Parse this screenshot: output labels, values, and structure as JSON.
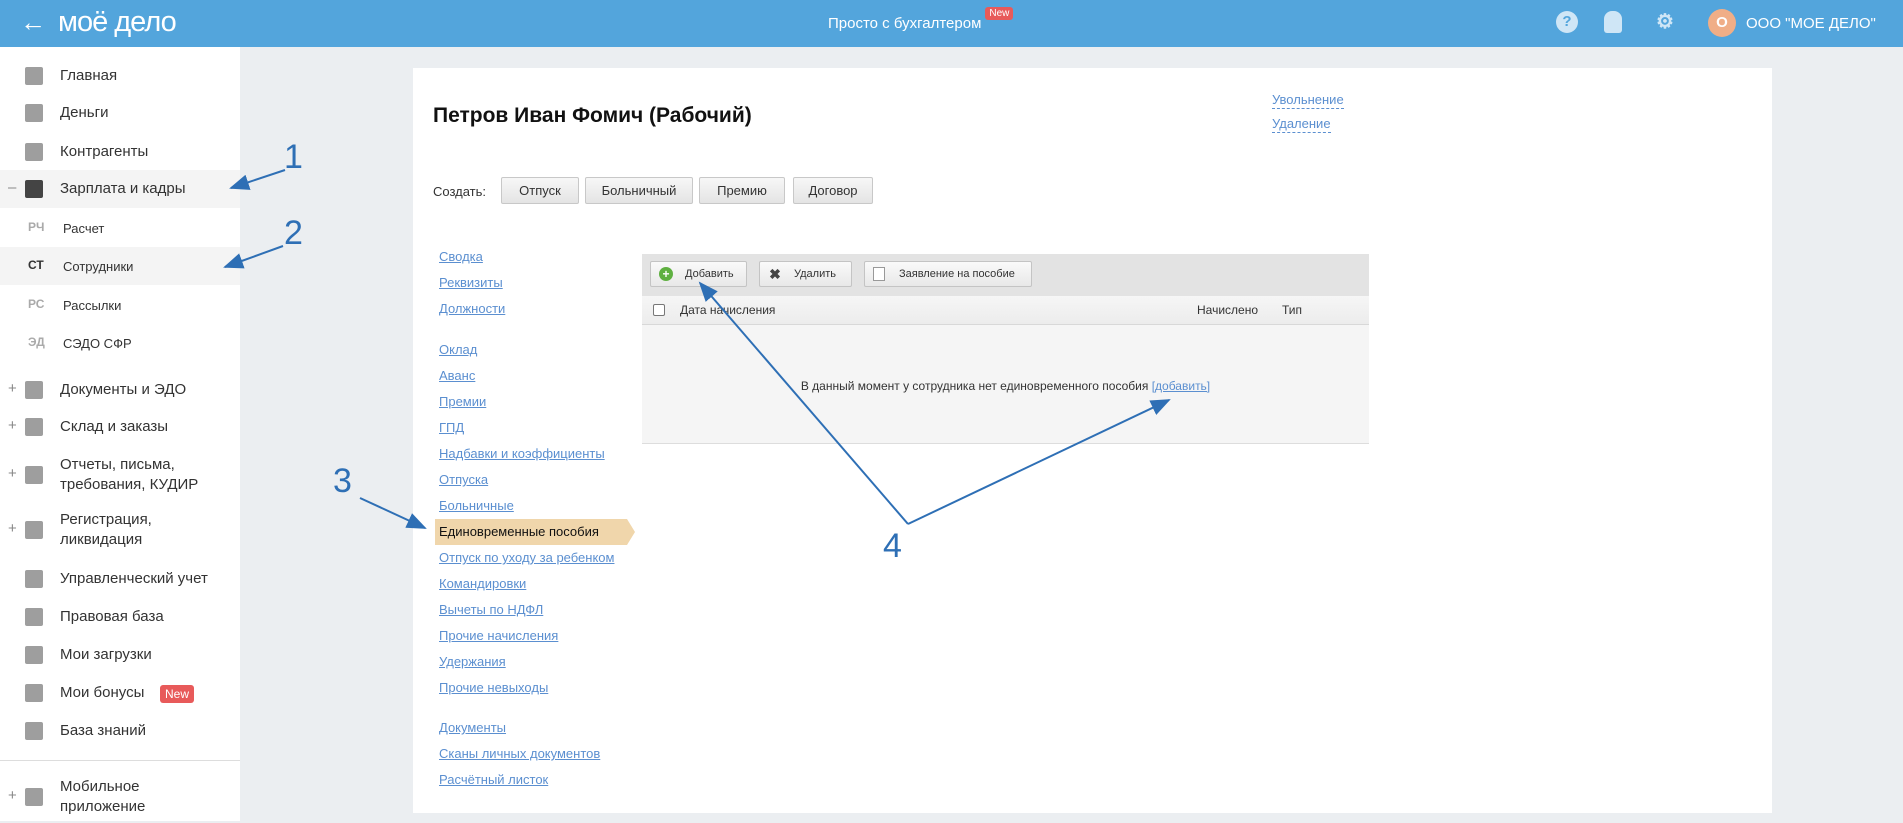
{
  "header": {
    "logo": "моё дело",
    "center_text": "Просто с бухгалтером",
    "center_badge": "New",
    "help_icon": "question-circle-icon",
    "bell_icon": "bell-icon",
    "settings_icon": "gear-icon",
    "avatar_letter": "О",
    "org_name": "ООО \"МОЕ ДЕЛО\"",
    "brand_color": "#53a5dc"
  },
  "sidebar": {
    "items": [
      {
        "label": "Главная",
        "icon": "home-icon"
      },
      {
        "label": "Деньги",
        "icon": "money-icon"
      },
      {
        "label": "Контрагенты",
        "icon": "person-icon"
      },
      {
        "label": "Зарплата и кадры",
        "icon": "wallet-icon",
        "toggle": "–"
      },
      {
        "label": "Документы и ЭДО",
        "icon": "folder-icon",
        "toggle": "+"
      },
      {
        "label": "Склад и заказы",
        "icon": "warehouse-icon",
        "toggle": "+"
      },
      {
        "label": "Отчеты, письма, требования, КУДИР",
        "icon": "report-icon",
        "toggle": "+"
      },
      {
        "label": "Регистрация, ликвидация",
        "icon": "registration-icon",
        "toggle": "+"
      },
      {
        "label": "Управленческий учет",
        "icon": "ruble-icon"
      },
      {
        "label": "Правовая база",
        "icon": "briefcase-icon"
      },
      {
        "label": "Мои загрузки",
        "icon": "folder-icon"
      },
      {
        "label": "Мои бонусы",
        "icon": "gift-icon",
        "badge": "New"
      },
      {
        "label": "База знаний",
        "icon": "graduation-cap-icon"
      },
      {
        "label": "Мобильное приложение",
        "icon": "mobile-icon",
        "toggle": "+"
      }
    ],
    "subitems": [
      {
        "abbr": "РЧ",
        "label": "Расчет"
      },
      {
        "abbr": "СТ",
        "label": "Сотрудники",
        "active": true
      },
      {
        "abbr": "РС",
        "label": "Рассылки"
      },
      {
        "abbr": "ЭД",
        "label": "СЭДО СФР"
      }
    ]
  },
  "employee": {
    "title": "Петров Иван Фомич (Рабочий)",
    "dismiss_link": "Увольнение",
    "delete_link": "Удаление",
    "create_label": "Создать:",
    "create_buttons": [
      "Отпуск",
      "Больничный",
      "Премию",
      "Договор"
    ]
  },
  "nav": {
    "groups": [
      [
        "Сводка",
        "Реквизиты",
        "Должности"
      ],
      [
        "Оклад",
        "Аванс",
        "Премии",
        "ГПД",
        "Надбавки и коэффициенты",
        "Отпуска",
        "Больничные",
        "Единовременные пособия",
        "Отпуск по уходу за ребенком",
        "Командировки",
        "Вычеты по НДФЛ",
        "Прочие начисления",
        "Удержания",
        "Прочие невыходы"
      ],
      [
        "Документы",
        "Сканы личных документов",
        "Расчётный листок"
      ]
    ],
    "selected": "Единовременные пособия",
    "selected_color": "#f0d6ab"
  },
  "grid": {
    "toolbar": [
      {
        "label": "Добавить",
        "icon": "plus-circle-icon"
      },
      {
        "label": "Удалить",
        "icon": "x-icon"
      },
      {
        "label": "Заявление на пособие",
        "icon": "document-icon"
      }
    ],
    "columns": [
      "Дата начисления",
      "Начислено",
      "Тип"
    ],
    "empty_text": "В данный момент у сотрудника нет единовременного пособия",
    "empty_link": "[добавить]"
  },
  "annotations": [
    "1",
    "2",
    "3",
    "4"
  ]
}
